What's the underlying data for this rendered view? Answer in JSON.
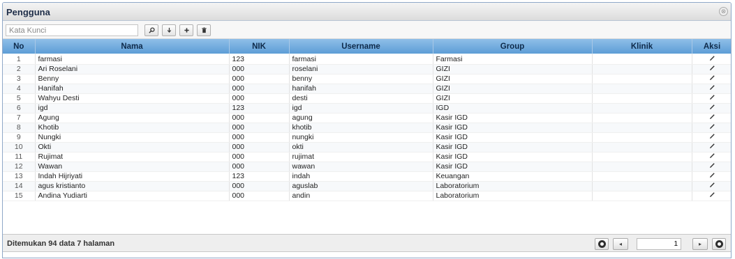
{
  "panel": {
    "title": "Pengguna",
    "close_glyph": "⊗"
  },
  "toolbar": {
    "search_placeholder": "Kata Kunci",
    "search_value": "",
    "icons": [
      "search-icon",
      "download-icon",
      "add-icon",
      "delete-icon"
    ]
  },
  "table": {
    "headers": {
      "no": "No",
      "nama": "Nama",
      "nik": "NIK",
      "username": "Username",
      "group": "Group",
      "klinik": "Klinik",
      "aksi": "Aksi"
    },
    "rows": [
      {
        "no": "1",
        "nama": "farmasi",
        "nik": "123",
        "username": "farmasi",
        "group": "Farmasi",
        "klinik": ""
      },
      {
        "no": "2",
        "nama": "Ari Roselani",
        "nik": "000",
        "username": "roselani",
        "group": "GIZI",
        "klinik": ""
      },
      {
        "no": "3",
        "nama": "Benny",
        "nik": "000",
        "username": "benny",
        "group": "GIZI",
        "klinik": ""
      },
      {
        "no": "4",
        "nama": "Hanifah",
        "nik": "000",
        "username": "hanifah",
        "group": "GIZI",
        "klinik": ""
      },
      {
        "no": "5",
        "nama": "Wahyu Desti",
        "nik": "000",
        "username": "desti",
        "group": "GIZI",
        "klinik": ""
      },
      {
        "no": "6",
        "nama": "igd",
        "nik": "123",
        "username": "igd",
        "group": "IGD",
        "klinik": ""
      },
      {
        "no": "7",
        "nama": "Agung",
        "nik": "000",
        "username": "agung",
        "group": "Kasir IGD",
        "klinik": ""
      },
      {
        "no": "8",
        "nama": "Khotib",
        "nik": "000",
        "username": "khotib",
        "group": "Kasir IGD",
        "klinik": ""
      },
      {
        "no": "9",
        "nama": "Nungki",
        "nik": "000",
        "username": "nungki",
        "group": "Kasir IGD",
        "klinik": ""
      },
      {
        "no": "10",
        "nama": "Okti",
        "nik": "000",
        "username": "okti",
        "group": "Kasir IGD",
        "klinik": ""
      },
      {
        "no": "11",
        "nama": "Rujimat",
        "nik": "000",
        "username": "rujimat",
        "group": "Kasir IGD",
        "klinik": ""
      },
      {
        "no": "12",
        "nama": "Wawan",
        "nik": "000",
        "username": "wawan",
        "group": "Kasir IGD",
        "klinik": ""
      },
      {
        "no": "13",
        "nama": "Indah Hijriyati",
        "nik": "123",
        "username": "indah",
        "group": "Keuangan",
        "klinik": ""
      },
      {
        "no": "14",
        "nama": "agus kristianto",
        "nik": "000",
        "username": "aguslab",
        "group": "Laboratorium",
        "klinik": ""
      },
      {
        "no": "15",
        "nama": "Andina Yudiarti",
        "nik": "000",
        "username": "andin",
        "group": "Laboratorium",
        "klinik": ""
      }
    ],
    "action_icon": "edit-pencil-icon"
  },
  "footer": {
    "info": "Ditemukan 94 data 7 halaman",
    "page_value": "1",
    "prev_glyph": "◂",
    "next_glyph": "▸"
  },
  "colors": {
    "header_bg": "#5d9dd6",
    "panel_border": "#8fa8c8",
    "title_text": "#1e2d48"
  }
}
